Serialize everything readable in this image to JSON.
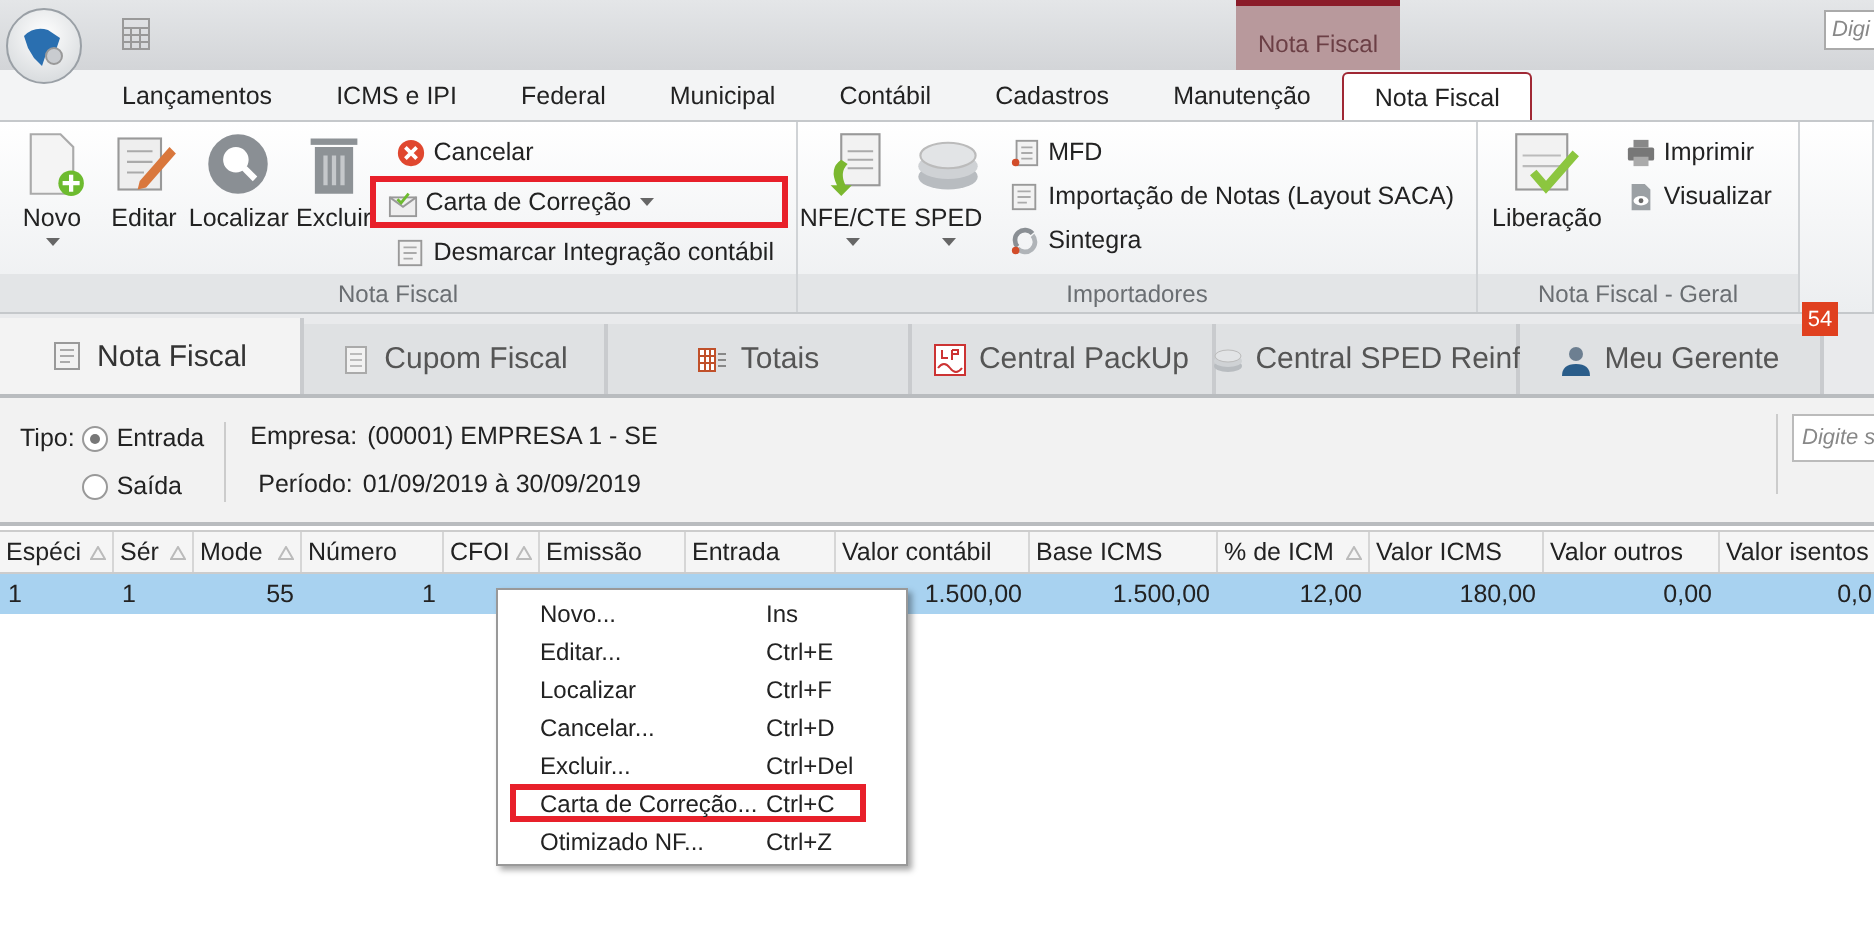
{
  "quick_access": {
    "search": {
      "placeholder": "Digi"
    }
  },
  "context_tab": {
    "label": "Nota Fiscal"
  },
  "ribbon_tabs": [
    {
      "label": "Lançamentos",
      "selected": false
    },
    {
      "label": "ICMS e IPI",
      "selected": false
    },
    {
      "label": "Federal",
      "selected": false
    },
    {
      "label": "Municipal",
      "selected": false
    },
    {
      "label": "Contábil",
      "selected": false
    },
    {
      "label": "Cadastros",
      "selected": false
    },
    {
      "label": "Manutenção",
      "selected": false
    },
    {
      "label": "Nota Fiscal",
      "selected": true
    }
  ],
  "ribbon_groups": [
    {
      "title": "Nota Fiscal",
      "large": [
        {
          "label": "Novo",
          "dropdown": true
        },
        {
          "label": "Editar",
          "dropdown": false
        },
        {
          "label": "Localizar",
          "dropdown": false
        },
        {
          "label": "Excluir",
          "dropdown": false
        }
      ],
      "small": [
        {
          "label": "Cancelar",
          "dropdown": false,
          "highlighted": false
        },
        {
          "label": "Carta de Correção",
          "dropdown": true,
          "highlighted": true
        },
        {
          "label": "Desmarcar Integração contábil",
          "dropdown": false,
          "highlighted": false
        }
      ]
    },
    {
      "title": "Importadores",
      "large": [
        {
          "label": "NFE/CTE",
          "dropdown": true
        },
        {
          "label": "SPED",
          "dropdown": true
        }
      ],
      "small": [
        {
          "label": "MFD",
          "dropdown": false,
          "highlighted": false
        },
        {
          "label": "Importação de Notas (Layout SACA)",
          "dropdown": false,
          "highlighted": false
        },
        {
          "label": "Sintegra",
          "dropdown": false,
          "highlighted": false
        }
      ]
    },
    {
      "title": "Nota Fiscal - Geral",
      "large": [
        {
          "label": "Liberação",
          "dropdown": false
        }
      ],
      "small": [
        {
          "label": "Imprimir",
          "dropdown": false,
          "highlighted": false
        },
        {
          "label": "Visualizar",
          "dropdown": false,
          "highlighted": false
        }
      ]
    }
  ],
  "doc_tabs": [
    {
      "label": "Nota Fiscal",
      "selected": true
    },
    {
      "label": "Cupom Fiscal",
      "selected": false
    },
    {
      "label": "Totais",
      "selected": false
    },
    {
      "label": "Central PackUp",
      "selected": false
    },
    {
      "label": "Central SPED Reinf",
      "selected": false
    },
    {
      "label": "Meu Gerente",
      "selected": false
    }
  ],
  "notification_badge": "54",
  "filter": {
    "tipo_label": "Tipo:",
    "options": [
      {
        "label": "Entrada",
        "selected": true
      },
      {
        "label": "Saída",
        "selected": false
      }
    ],
    "empresa_label": "Empresa:",
    "empresa": "(00001) EMPRESA 1 - SE",
    "periodo_label": "Período:",
    "periodo": "01/09/2019 à 30/09/2019",
    "search": {
      "placeholder": "Digite s"
    }
  },
  "table": {
    "columns": [
      {
        "label": "Espéci",
        "sortable": true
      },
      {
        "label": "Sér",
        "sortable": true
      },
      {
        "label": "Mode",
        "sortable": true
      },
      {
        "label": "Número",
        "sortable": false
      },
      {
        "label": "CFOI",
        "sortable": true
      },
      {
        "label": "Emissão",
        "sortable": false
      },
      {
        "label": "Entrada",
        "sortable": false
      },
      {
        "label": "Valor contábil",
        "sortable": false
      },
      {
        "label": "Base ICMS",
        "sortable": false
      },
      {
        "label": "% de ICM",
        "sortable": true
      },
      {
        "label": "Valor ICMS",
        "sortable": false
      },
      {
        "label": "Valor outros",
        "sortable": false
      },
      {
        "label": "Valor isentos",
        "sortable": false
      }
    ],
    "rows": [
      {
        "selected": true,
        "cells": [
          "1",
          "1",
          "55",
          "1",
          null,
          null,
          null,
          "1.500,00",
          "1.500,00",
          "12,00",
          "180,00",
          "0,00",
          "0,0"
        ]
      }
    ]
  },
  "context_menu": [
    {
      "label": "Novo...",
      "shortcut": "Ins",
      "highlighted": false
    },
    {
      "label": "Editar...",
      "shortcut": "Ctrl+E",
      "highlighted": false
    },
    {
      "label": "Localizar",
      "shortcut": "Ctrl+F",
      "highlighted": false
    },
    {
      "label": "Cancelar...",
      "shortcut": "Ctrl+D",
      "highlighted": false
    },
    {
      "label": "Excluir...",
      "shortcut": "Ctrl+Del",
      "highlighted": false
    },
    {
      "label": "Carta de Correção...",
      "shortcut": "Ctrl+C",
      "highlighted": true
    },
    {
      "label": "Otimizado NF...",
      "shortcut": "Ctrl+Z",
      "highlighted": false
    }
  ]
}
